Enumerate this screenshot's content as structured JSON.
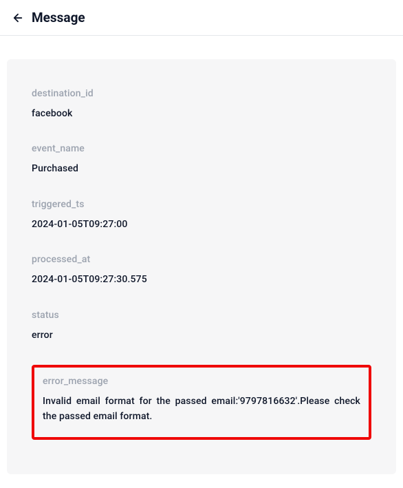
{
  "header": {
    "title": "Message"
  },
  "fields": {
    "destination_id": {
      "label": "destination_id",
      "value": "facebook"
    },
    "event_name": {
      "label": "event_name",
      "value": "Purchased"
    },
    "triggered_ts": {
      "label": "triggered_ts",
      "value": "2024-01-05T09:27:00"
    },
    "processed_at": {
      "label": "processed_at",
      "value": "2024-01-05T09:27:30.575"
    },
    "status": {
      "label": "status",
      "value": "error"
    },
    "error_message": {
      "label": "error_message",
      "value": "Invalid email format for the passed email:'9797816632'.Please check the passed email format."
    }
  }
}
